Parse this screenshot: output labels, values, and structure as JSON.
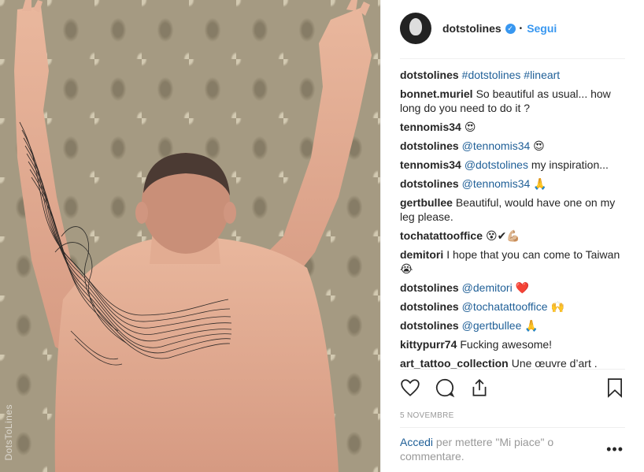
{
  "post": {
    "watermark": "DotsToLines",
    "date": "5 NOVEMBRE"
  },
  "header": {
    "username": "dotstolines",
    "verified_icon": "verified-badge-icon",
    "separator": "•",
    "follow_label": "Segui"
  },
  "comments": [
    {
      "user": "dotstolines",
      "segments": [
        {
          "text": "#dotstolines",
          "link": true
        },
        {
          "text": " ",
          "link": false
        },
        {
          "text": "#lineart",
          "link": true
        }
      ]
    },
    {
      "user": "bonnet.muriel",
      "segments": [
        {
          "text": "So beautiful as usual... how long do you need to do it ?",
          "link": false
        }
      ]
    },
    {
      "user": "tennomis34",
      "segments": [
        {
          "text": "😍",
          "link": false
        }
      ]
    },
    {
      "user": "dotstolines",
      "segments": [
        {
          "text": "@tennomis34",
          "link": true
        },
        {
          "text": " 😍",
          "link": false
        }
      ]
    },
    {
      "user": "tennomis34",
      "segments": [
        {
          "text": "@dotstolines",
          "link": true
        },
        {
          "text": " my inspiration...",
          "link": false
        }
      ]
    },
    {
      "user": "dotstolines",
      "segments": [
        {
          "text": "@tennomis34",
          "link": true
        },
        {
          "text": " 🙏",
          "link": false
        }
      ]
    },
    {
      "user": "gertbullee",
      "segments": [
        {
          "text": "Beautiful, would have one on my leg please.",
          "link": false
        }
      ]
    },
    {
      "user": "tochatattooffice",
      "segments": [
        {
          "text": "😵✔💪🏼",
          "link": false
        }
      ]
    },
    {
      "user": "demitori",
      "segments": [
        {
          "text": "I hope that you can come to Taiwan😭",
          "link": false
        }
      ]
    },
    {
      "user": "dotstolines",
      "segments": [
        {
          "text": "@demitori",
          "link": true
        },
        {
          "text": " ❤️",
          "link": false
        }
      ]
    },
    {
      "user": "dotstolines",
      "segments": [
        {
          "text": "@tochatattooffice",
          "link": true
        },
        {
          "text": " 🙌",
          "link": false
        }
      ]
    },
    {
      "user": "dotstolines",
      "segments": [
        {
          "text": "@gertbullee",
          "link": true
        },
        {
          "text": " 🙏",
          "link": false
        }
      ]
    },
    {
      "user": "kittypurr74",
      "segments": [
        {
          "text": "Fucking awesome!",
          "link": false
        }
      ]
    },
    {
      "user": "art_tattoo_collection",
      "segments": [
        {
          "text": "Une œuvre d’art .",
          "link": false
        }
      ]
    }
  ],
  "actions": {
    "like_icon": "heart-icon",
    "comment_icon": "comment-icon",
    "share_icon": "share-icon",
    "save_icon": "bookmark-icon"
  },
  "footer": {
    "login_link": "Accedi",
    "login_text": " per mettere \"Mi piace\" o commentare.",
    "more_icon": "more-options-icon",
    "more_glyph": "•••"
  },
  "colors": {
    "link": "#1f5f97",
    "accent": "#3897f0",
    "muted": "#999999",
    "text": "#262626"
  }
}
